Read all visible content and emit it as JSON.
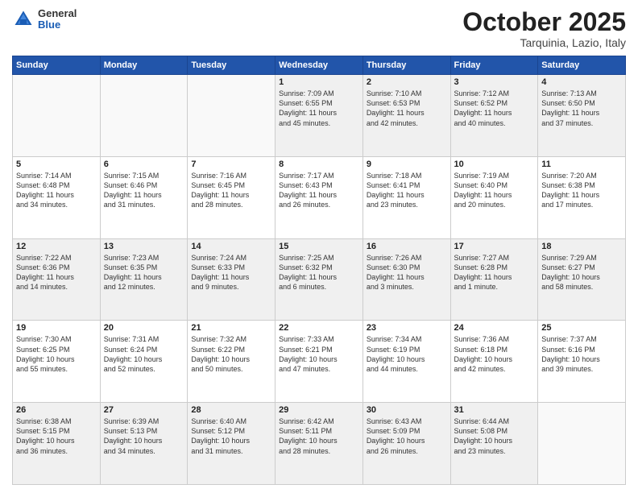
{
  "logo": {
    "general": "General",
    "blue": "Blue"
  },
  "header": {
    "month": "October 2025",
    "location": "Tarquinia, Lazio, Italy"
  },
  "days_of_week": [
    "Sunday",
    "Monday",
    "Tuesday",
    "Wednesday",
    "Thursday",
    "Friday",
    "Saturday"
  ],
  "weeks": [
    [
      {
        "day": "",
        "info": ""
      },
      {
        "day": "",
        "info": ""
      },
      {
        "day": "",
        "info": ""
      },
      {
        "day": "1",
        "info": "Sunrise: 7:09 AM\nSunset: 6:55 PM\nDaylight: 11 hours\nand 45 minutes."
      },
      {
        "day": "2",
        "info": "Sunrise: 7:10 AM\nSunset: 6:53 PM\nDaylight: 11 hours\nand 42 minutes."
      },
      {
        "day": "3",
        "info": "Sunrise: 7:12 AM\nSunset: 6:52 PM\nDaylight: 11 hours\nand 40 minutes."
      },
      {
        "day": "4",
        "info": "Sunrise: 7:13 AM\nSunset: 6:50 PM\nDaylight: 11 hours\nand 37 minutes."
      }
    ],
    [
      {
        "day": "5",
        "info": "Sunrise: 7:14 AM\nSunset: 6:48 PM\nDaylight: 11 hours\nand 34 minutes."
      },
      {
        "day": "6",
        "info": "Sunrise: 7:15 AM\nSunset: 6:46 PM\nDaylight: 11 hours\nand 31 minutes."
      },
      {
        "day": "7",
        "info": "Sunrise: 7:16 AM\nSunset: 6:45 PM\nDaylight: 11 hours\nand 28 minutes."
      },
      {
        "day": "8",
        "info": "Sunrise: 7:17 AM\nSunset: 6:43 PM\nDaylight: 11 hours\nand 26 minutes."
      },
      {
        "day": "9",
        "info": "Sunrise: 7:18 AM\nSunset: 6:41 PM\nDaylight: 11 hours\nand 23 minutes."
      },
      {
        "day": "10",
        "info": "Sunrise: 7:19 AM\nSunset: 6:40 PM\nDaylight: 11 hours\nand 20 minutes."
      },
      {
        "day": "11",
        "info": "Sunrise: 7:20 AM\nSunset: 6:38 PM\nDaylight: 11 hours\nand 17 minutes."
      }
    ],
    [
      {
        "day": "12",
        "info": "Sunrise: 7:22 AM\nSunset: 6:36 PM\nDaylight: 11 hours\nand 14 minutes."
      },
      {
        "day": "13",
        "info": "Sunrise: 7:23 AM\nSunset: 6:35 PM\nDaylight: 11 hours\nand 12 minutes."
      },
      {
        "day": "14",
        "info": "Sunrise: 7:24 AM\nSunset: 6:33 PM\nDaylight: 11 hours\nand 9 minutes."
      },
      {
        "day": "15",
        "info": "Sunrise: 7:25 AM\nSunset: 6:32 PM\nDaylight: 11 hours\nand 6 minutes."
      },
      {
        "day": "16",
        "info": "Sunrise: 7:26 AM\nSunset: 6:30 PM\nDaylight: 11 hours\nand 3 minutes."
      },
      {
        "day": "17",
        "info": "Sunrise: 7:27 AM\nSunset: 6:28 PM\nDaylight: 11 hours\nand 1 minute."
      },
      {
        "day": "18",
        "info": "Sunrise: 7:29 AM\nSunset: 6:27 PM\nDaylight: 10 hours\nand 58 minutes."
      }
    ],
    [
      {
        "day": "19",
        "info": "Sunrise: 7:30 AM\nSunset: 6:25 PM\nDaylight: 10 hours\nand 55 minutes."
      },
      {
        "day": "20",
        "info": "Sunrise: 7:31 AM\nSunset: 6:24 PM\nDaylight: 10 hours\nand 52 minutes."
      },
      {
        "day": "21",
        "info": "Sunrise: 7:32 AM\nSunset: 6:22 PM\nDaylight: 10 hours\nand 50 minutes."
      },
      {
        "day": "22",
        "info": "Sunrise: 7:33 AM\nSunset: 6:21 PM\nDaylight: 10 hours\nand 47 minutes."
      },
      {
        "day": "23",
        "info": "Sunrise: 7:34 AM\nSunset: 6:19 PM\nDaylight: 10 hours\nand 44 minutes."
      },
      {
        "day": "24",
        "info": "Sunrise: 7:36 AM\nSunset: 6:18 PM\nDaylight: 10 hours\nand 42 minutes."
      },
      {
        "day": "25",
        "info": "Sunrise: 7:37 AM\nSunset: 6:16 PM\nDaylight: 10 hours\nand 39 minutes."
      }
    ],
    [
      {
        "day": "26",
        "info": "Sunrise: 6:38 AM\nSunset: 5:15 PM\nDaylight: 10 hours\nand 36 minutes."
      },
      {
        "day": "27",
        "info": "Sunrise: 6:39 AM\nSunset: 5:13 PM\nDaylight: 10 hours\nand 34 minutes."
      },
      {
        "day": "28",
        "info": "Sunrise: 6:40 AM\nSunset: 5:12 PM\nDaylight: 10 hours\nand 31 minutes."
      },
      {
        "day": "29",
        "info": "Sunrise: 6:42 AM\nSunset: 5:11 PM\nDaylight: 10 hours\nand 28 minutes."
      },
      {
        "day": "30",
        "info": "Sunrise: 6:43 AM\nSunset: 5:09 PM\nDaylight: 10 hours\nand 26 minutes."
      },
      {
        "day": "31",
        "info": "Sunrise: 6:44 AM\nSunset: 5:08 PM\nDaylight: 10 hours\nand 23 minutes."
      },
      {
        "day": "",
        "info": ""
      }
    ]
  ]
}
